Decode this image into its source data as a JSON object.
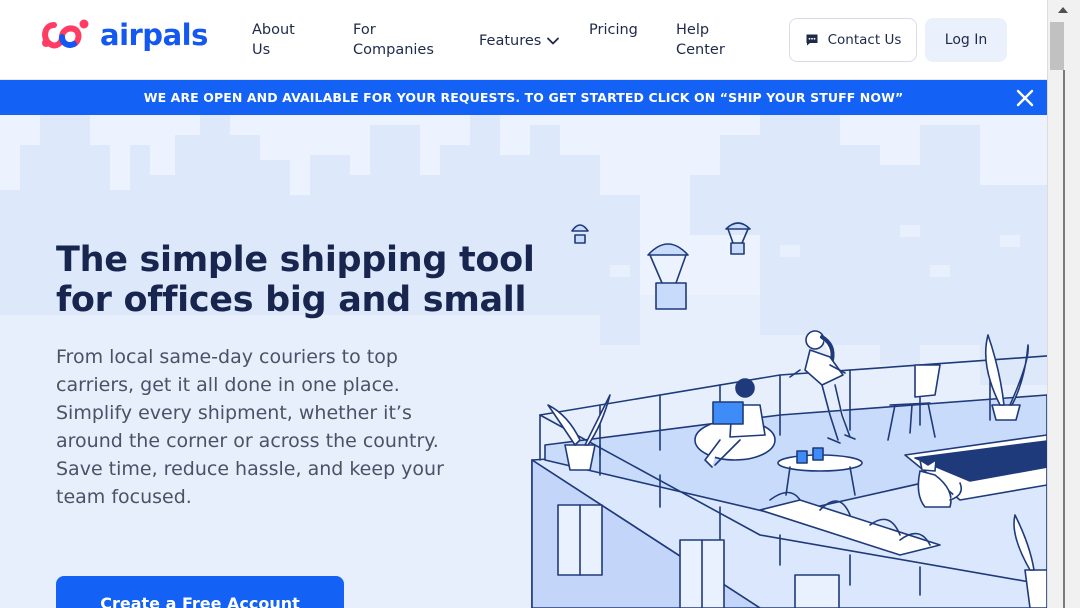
{
  "brand": {
    "name": "airpals",
    "color": "#1358f0",
    "accent": "#ff3d64"
  },
  "nav": {
    "about": "About\nUs",
    "companies": "For\nCompanies",
    "features": "Features",
    "pricing": "Pricing",
    "help": "Help\nCenter"
  },
  "actions": {
    "contact": "Contact Us",
    "login": "Log In"
  },
  "banner": {
    "text": "WE ARE OPEN AND AVAILABLE FOR YOUR REQUESTS. TO GET STARTED CLICK ON “SHIP YOUR STUFF NOW”",
    "color": "#1462f5"
  },
  "hero": {
    "title": "The simple shipping tool for offices big and small",
    "description": "From local same-day couriers to top carriers, get it all done in one place. Simplify every shipment, whether it’s around the corner or across the country. Save time, reduce hassle, and keep your team focused.",
    "cta": "Create a Free Account"
  },
  "icons": [
    "logo-icon",
    "chevron-down-icon",
    "chat-icon",
    "close-icon"
  ]
}
